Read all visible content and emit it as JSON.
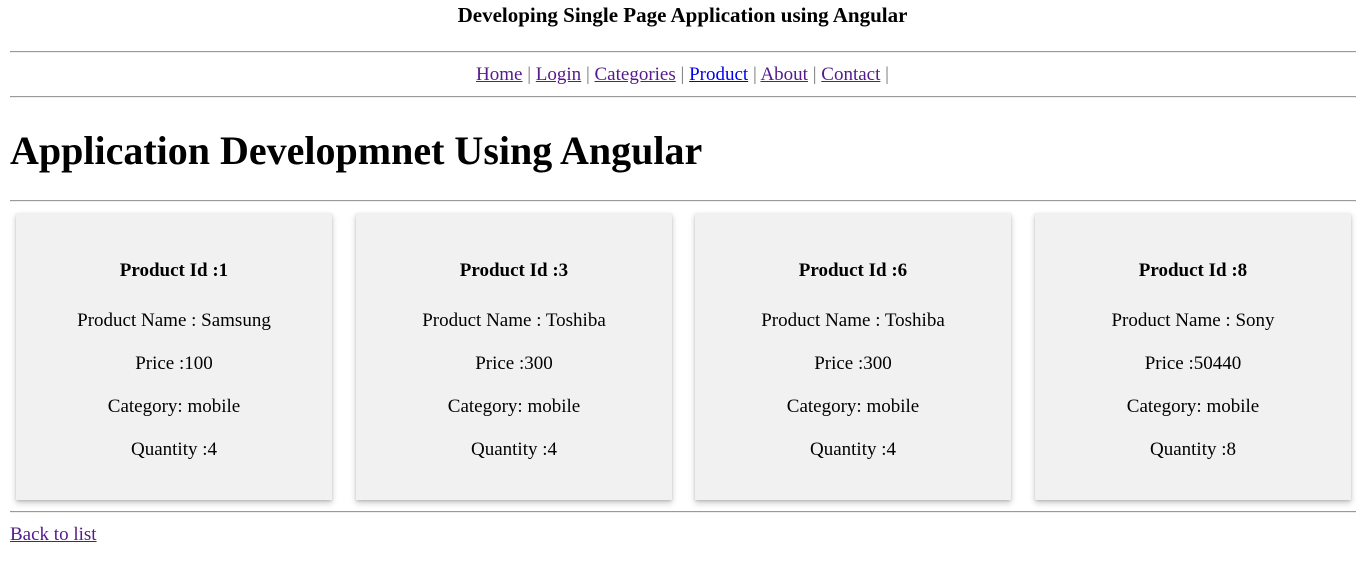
{
  "header": {
    "title": "Developing Single Page Application using Angular"
  },
  "nav": {
    "separator": "|",
    "links": [
      {
        "label": "Home"
      },
      {
        "label": "Login"
      },
      {
        "label": "Categories"
      },
      {
        "label": "Product"
      },
      {
        "label": "About"
      },
      {
        "label": "Contact"
      }
    ]
  },
  "main": {
    "heading": "Application Developmnet Using Angular",
    "products": [
      {
        "id_text": "Product Id :1",
        "name_text": "Product Name : Samsung",
        "price_text": "Price :100",
        "category_text": "Category: mobile",
        "quantity_text": "Quantity :4"
      },
      {
        "id_text": "Product Id :3",
        "name_text": "Product Name : Toshiba",
        "price_text": "Price :300",
        "category_text": "Category: mobile",
        "quantity_text": "Quantity :4"
      },
      {
        "id_text": "Product Id :6",
        "name_text": "Product Name : Toshiba",
        "price_text": "Price :300",
        "category_text": "Category: mobile",
        "quantity_text": "Quantity :4"
      },
      {
        "id_text": "Product Id :8",
        "name_text": "Product Name : Sony",
        "price_text": "Price :50440",
        "category_text": "Category: mobile",
        "quantity_text": "Quantity :8"
      }
    ],
    "back_link": "Back to list"
  },
  "colors": {
    "visited_link": "#551a8b",
    "active_link": "#0000ee",
    "card_background": "#f1f1f1",
    "rule": "#9a9a9a"
  }
}
